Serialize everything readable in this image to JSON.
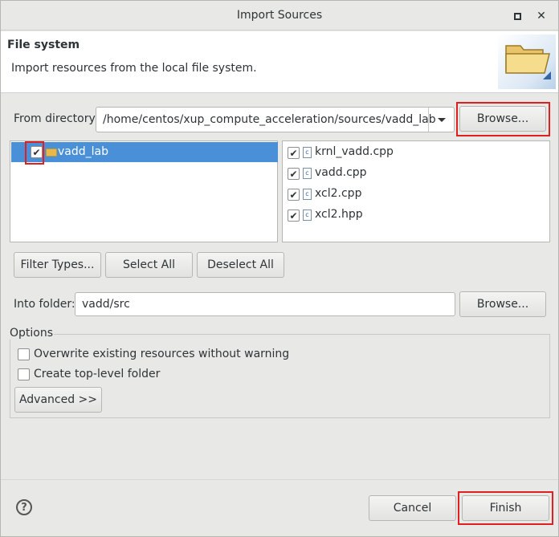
{
  "window": {
    "title": "Import Sources"
  },
  "header": {
    "title": "File system",
    "description": "Import resources from the local file system."
  },
  "from_directory": {
    "label": "From directory:",
    "value": "/home/centos/xup_compute_acceleration/sources/vadd_lab",
    "browse_label": "Browse..."
  },
  "folder_tree": [
    {
      "name": "vadd_lab",
      "checked": true,
      "selected": true
    }
  ],
  "files": [
    {
      "name": "krnl_vadd.cpp",
      "checked": true,
      "icon": "c-source-file-icon"
    },
    {
      "name": "vadd.cpp",
      "checked": true,
      "icon": "c-source-file-icon"
    },
    {
      "name": "xcl2.cpp",
      "checked": true,
      "icon": "c-source-file-icon"
    },
    {
      "name": "xcl2.hpp",
      "checked": true,
      "icon": "c-source-file-icon"
    }
  ],
  "selection_buttons": {
    "filter_types": "Filter Types...",
    "select_all": "Select All",
    "deselect_all": "Deselect All"
  },
  "into_folder": {
    "label": "Into folder:",
    "value": "vadd/src",
    "browse_label": "Browse..."
  },
  "options": {
    "title": "Options",
    "overwrite_label": "Overwrite existing resources without warning",
    "overwrite_checked": false,
    "create_top_level_label": "Create top-level folder",
    "create_top_level_checked": false,
    "advanced_label": "Advanced >>"
  },
  "footer": {
    "help_glyph": "?",
    "cancel_label": "Cancel",
    "finish_label": "Finish"
  },
  "colors": {
    "highlight_box": "#e02020",
    "selection": "#4a90d9"
  }
}
